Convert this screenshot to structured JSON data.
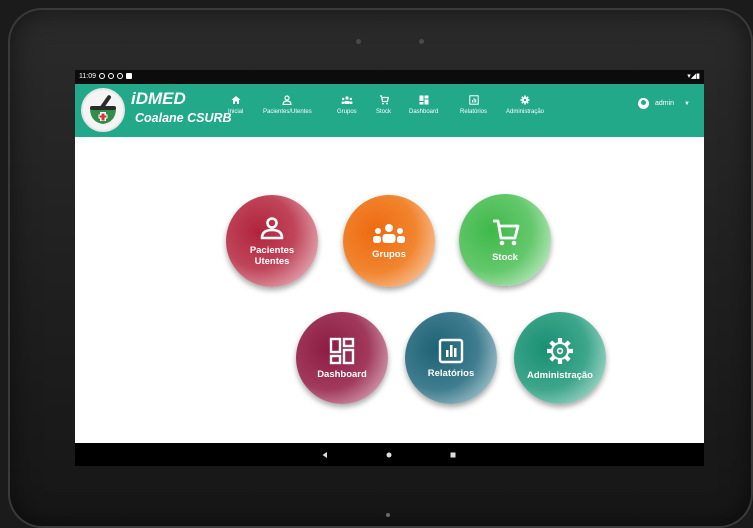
{
  "status": {
    "time": "11:09"
  },
  "app": {
    "title": "iDMED",
    "subtitle": "Coalane CSURB"
  },
  "nav": [
    {
      "label": "Inicial",
      "icon": "home-icon"
    },
    {
      "label": "Pacientes/Utentes",
      "icon": "person-icon"
    },
    {
      "label": "Grupos",
      "icon": "groups-icon"
    },
    {
      "label": "Stock",
      "icon": "cart-icon"
    },
    {
      "label": "Dashboard",
      "icon": "dashboard-icon"
    },
    {
      "label": "Relatórios",
      "icon": "report-icon"
    },
    {
      "label": "Administração",
      "icon": "gear-icon"
    }
  ],
  "user": {
    "name": "admin"
  },
  "tiles": [
    {
      "line1": "Pacientes",
      "line2": "Utentes",
      "icon": "person-icon",
      "color": "#b0243c"
    },
    {
      "label": "Grupos",
      "icon": "groups-icon",
      "color": "#ee6a10"
    },
    {
      "label": "Stock",
      "icon": "cart-icon",
      "color": "#3fb84a"
    },
    {
      "label": "Dashboard",
      "icon": "dashboard-icon",
      "color": "#8c1c42"
    },
    {
      "label": "Relatórios",
      "icon": "report-icon",
      "color": "#1f6275"
    },
    {
      "label": "Administração",
      "icon": "gear-icon",
      "color": "#1a8f72"
    }
  ],
  "colors": {
    "primary": "#21a98a"
  }
}
